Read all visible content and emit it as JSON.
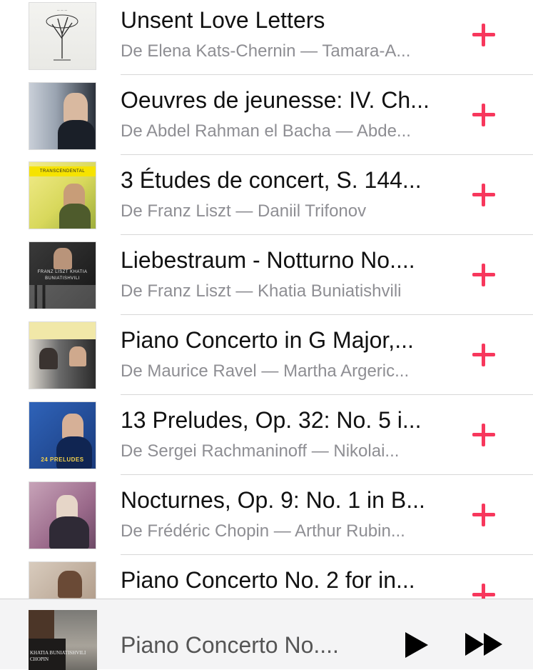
{
  "songs": [
    {
      "title": "Unsent Love Letters",
      "subtitle": "De Elena Kats-Chernin — Tamara-A...",
      "art": {
        "icon": "album-art-tree",
        "colors": [
          "#f2f2ef",
          "#e8e8e4"
        ]
      }
    },
    {
      "title": "Oeuvres de jeunesse: IV. Ch...",
      "subtitle": "De Abdel Rahman el Bacha — Abde...",
      "art": {
        "icon": "album-art-portrait",
        "colors": [
          "#8f9aa8",
          "#1d2430"
        ]
      }
    },
    {
      "title": "3 Études de concert, S. 144...",
      "subtitle": "De Franz Liszt — Daniil Trifonov",
      "art": {
        "icon": "album-art-portrait",
        "colors": [
          "#e8e26a",
          "#b7c043"
        ],
        "band": "TRANSCENDENTAL"
      }
    },
    {
      "title": "Liebestraum - Notturno No....",
      "subtitle": "De Franz Liszt — Khatia Buniatishvili",
      "art": {
        "icon": "album-art-portrait",
        "colors": [
          "#2a2a2a",
          "#0e0e0e"
        ],
        "band": "FRANZ LISZT KHATIA BUNIATISHVILI"
      }
    },
    {
      "title": "Piano Concerto in G Major,...",
      "subtitle": "De Maurice Ravel — Martha Argeric...",
      "art": {
        "icon": "album-art-photo",
        "colors": [
          "#efe5a0",
          "#444444"
        ]
      }
    },
    {
      "title": "13 Preludes, Op. 32: No. 5 i...",
      "subtitle": "De Sergei Rachmaninoff — Nikolai...",
      "art": {
        "icon": "album-art-portrait",
        "colors": [
          "#1c3f86",
          "#2a5db5"
        ],
        "band": "24 PRELUDES"
      }
    },
    {
      "title": "Nocturnes, Op. 9: No. 1 in B...",
      "subtitle": "De Frédéric Chopin — Arthur Rubin...",
      "art": {
        "icon": "album-art-painting",
        "colors": [
          "#b38fa3",
          "#8a5c79"
        ]
      }
    },
    {
      "title": "Piano Concerto No. 2 for in...",
      "subtitle": "",
      "art": {
        "icon": "album-art-portrait",
        "colors": [
          "#c8b7a4",
          "#7a6250"
        ]
      }
    }
  ],
  "player": {
    "now_playing_title": "Piano Concerto No....",
    "art_caption": "KHATIA BUNIATISHVILI CHOPIN",
    "play_icon": "play-icon",
    "next_icon": "fast-forward-icon"
  },
  "colors": {
    "accent": "#f7375c",
    "subtitle": "#8e8e93",
    "separator": "#d8d8d8"
  }
}
